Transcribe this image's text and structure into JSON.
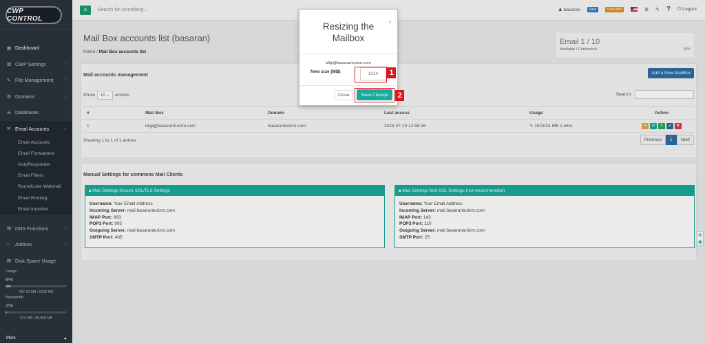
{
  "app": {
    "logo": "CWP CONTROL"
  },
  "sidebar": {
    "items": [
      {
        "icon": "dashboard-icon",
        "glyph": "▦",
        "label": "Dashboard",
        "chevron": ""
      },
      {
        "icon": "chart-icon",
        "glyph": "▥",
        "label": "CWP Settings",
        "chevron": "‹"
      },
      {
        "icon": "edit-icon",
        "glyph": "✎",
        "label": "File Management",
        "chevron": "‹"
      },
      {
        "icon": "globe-icon",
        "glyph": "◍",
        "label": "Domains",
        "chevron": "‹"
      },
      {
        "icon": "database-icon",
        "glyph": "☰",
        "label": "Databases",
        "chevron": "‹"
      },
      {
        "icon": "envelope-icon",
        "glyph": "✉",
        "label": "Email Accounts",
        "chevron": "⌄"
      }
    ],
    "email_sub": [
      "Email Accounts",
      "Email Forwarders",
      "AutoResponder",
      "Email Filters",
      "Roundcube Webmail",
      "Email Routing",
      "Email Importer"
    ],
    "items_after": [
      {
        "icon": "dns-icon",
        "glyph": "▤",
        "label": "DNS Functions",
        "chevron": "‹"
      },
      {
        "icon": "bank-icon",
        "glyph": "⌂",
        "label": "Addons",
        "chevron": "‹"
      },
      {
        "icon": "disk-icon",
        "glyph": "▤",
        "label": "Disk Space Usage",
        "chevron": ""
      }
    ],
    "usage": {
      "label": "Usage",
      "percent": "9%",
      "fill": 0.09,
      "detail": "457.00 MB / 5000 MB"
    },
    "bandwidth": {
      "label": "Bandwidth",
      "percent": "2%",
      "fill": 0.02,
      "detail": "513 MB / 30,000 MB"
    },
    "more": "More",
    "more_arrow": "◂"
  },
  "topbar": {
    "menu_glyph": "≡",
    "search_placeholder": "Search for something...",
    "user": "basaran",
    "new_badge": "New",
    "unlocked_badge": "Unlocked",
    "logout": "Logout"
  },
  "page": {
    "title": "Mail Box accounts list (basaran)",
    "breadcrumb_home": "Home",
    "breadcrumb_sep": "/",
    "breadcrumb_current": "Mail Box accounts list"
  },
  "email_box": {
    "count": "Email 1 / 10",
    "sub": "Available / Contracted",
    "percent": "10%"
  },
  "management": {
    "title": "Mail accounts management",
    "add_button": "Add a New MailBox",
    "show": "Show",
    "entries_value": "10",
    "entries": "entries",
    "search_label": "Search:",
    "columns": [
      "#",
      "Mail Box",
      "Domain",
      "Last access",
      "Usage",
      "Action"
    ],
    "rows": [
      {
        "num": "1",
        "mailbox": "bilgi@basaranturizm.com",
        "domain": "basaranturizm.com",
        "last_access": "2023-07-19 13:58:26",
        "usage": "15/1024 MB 1.46%"
      }
    ],
    "showing": "Showing 1 to 1 of 1 entries",
    "pager": {
      "prev": "Previous",
      "page": "1",
      "next": "Next"
    }
  },
  "manual": {
    "title": "Manual Settings for commons Mail Clients",
    "ssl": {
      "header": "Mail Settings Secure SSL/TLS Settings",
      "lines": [
        {
          "k": "Username:",
          "v": "Your Email Address"
        },
        {
          "k": "Incoming Server:",
          "v": "mail.basaranturizm.com"
        },
        {
          "k": "IMAP Port:",
          "v": "993"
        },
        {
          "k": "POP3 Port:",
          "v": "995"
        },
        {
          "k": "Outgoing Server:",
          "v": "mail.basaranturizm.com"
        },
        {
          "k": "SMTP Port:",
          "v": "465"
        }
      ]
    },
    "nonssl": {
      "header": "Mail Settings Non-SSL Settings (not recommended)",
      "lines": [
        {
          "k": "Username:",
          "v": "Your Email Address"
        },
        {
          "k": "Incoming Server:",
          "v": "mail.basaranturizm.com"
        },
        {
          "k": "IMAP Port:",
          "v": "143"
        },
        {
          "k": "POP3 Port:",
          "v": "110"
        },
        {
          "k": "Outgoing Server:",
          "v": "mail.basaranturizm.com"
        },
        {
          "k": "SMTP Port:",
          "v": "25"
        }
      ]
    }
  },
  "modal": {
    "title": "Resizing the Mailbox",
    "close_x": "×",
    "email": "bilgi@basaranturizm.com",
    "size_label": "New size (MB)",
    "size_value": "1024",
    "close_button": "Close",
    "save_button": "Save Change",
    "marker_1": "1",
    "marker_2": "2"
  },
  "colors": {
    "accent": "#1aa99a",
    "primary": "#2e6da4",
    "highlight": "#e0141e",
    "sidebar": "#2b333e"
  }
}
